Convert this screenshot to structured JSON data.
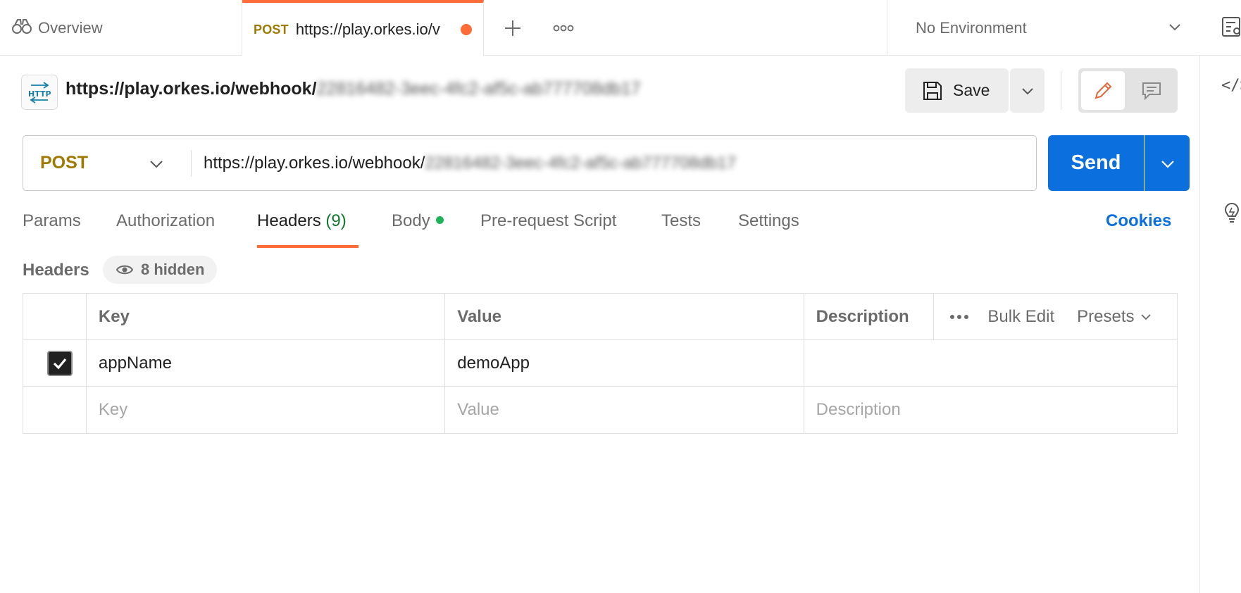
{
  "tabs": {
    "overview_label": "Overview",
    "active": {
      "method": "POST",
      "title": "https://play.orkes.io/v"
    }
  },
  "environment": {
    "selected": "No Environment"
  },
  "request": {
    "title_prefix": "https://play.orkes.io/webhook/",
    "title_obscured": "22816482-3eec-4fc2-af5c-ab777708db17",
    "method": "POST",
    "url_prefix": "https://play.orkes.io/webhook/",
    "url_obscured": "22816482-3eec-4fc2-af5c-ab777708db17",
    "save_label": "Save",
    "send_label": "Send"
  },
  "request_tabs": {
    "params": "Params",
    "authorization": "Authorization",
    "headers": "Headers",
    "headers_count": "(9)",
    "body": "Body",
    "prerequest": "Pre-request Script",
    "tests": "Tests",
    "settings": "Settings",
    "cookies": "Cookies"
  },
  "headers_section": {
    "title": "Headers",
    "hidden_label": "8 hidden"
  },
  "table": {
    "columns": {
      "key": "Key",
      "value": "Value",
      "description": "Description",
      "bulk_edit": "Bulk Edit",
      "presets": "Presets"
    },
    "rows": [
      {
        "checked": true,
        "key": "appName",
        "value": "demoApp",
        "description": ""
      }
    ],
    "placeholders": {
      "key": "Key",
      "value": "Value",
      "description": "Description"
    }
  },
  "colors": {
    "accent_orange": "#ff6c37",
    "send_blue": "#0c6fde",
    "method_post": "#9e7a00",
    "count_green": "#0f7a2e"
  },
  "icons": [
    "binoculars-icon",
    "plus-icon",
    "more-icon",
    "chevron-down-icon",
    "environment-quicklook-icon",
    "http-icon",
    "save-icon",
    "pencil-icon",
    "comment-icon",
    "code-icon",
    "lightbulb-icon",
    "eye-icon",
    "checkmark-icon"
  ]
}
